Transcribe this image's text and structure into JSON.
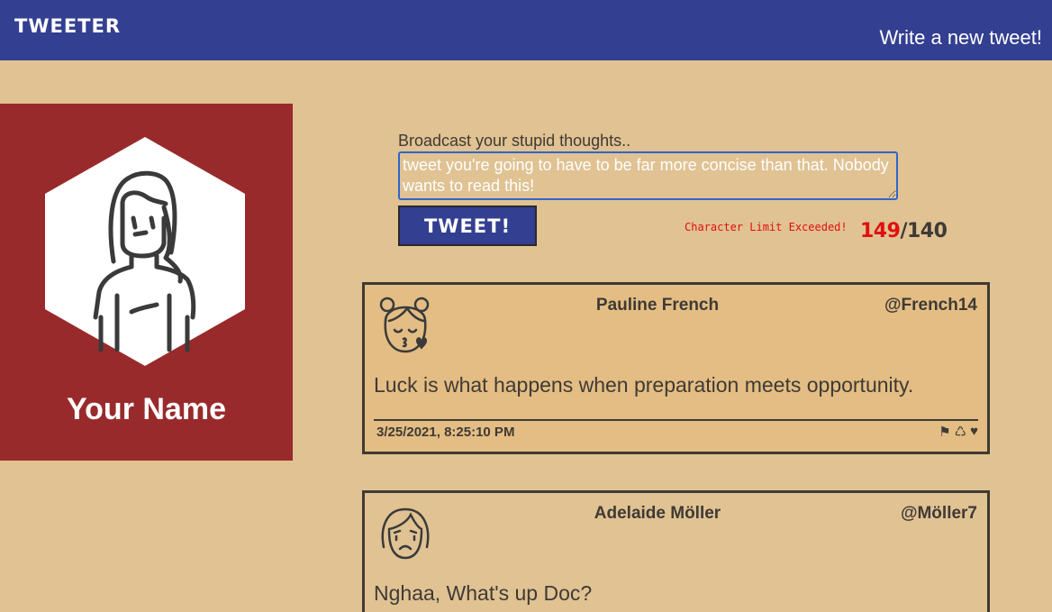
{
  "nav": {
    "brand": "TWEETER",
    "write_link": "Write a new tweet!"
  },
  "profile": {
    "name": "Your Name",
    "avatar_icon": "woman-avatar-icon"
  },
  "compose": {
    "label": "Broadcast your stupid thoughts..",
    "value": "tweet you're going to have to be far more concise than that. Nobody wants to read this!",
    "button_label": "TWEET!",
    "limit_message": "Character Limit Exceeded!",
    "count": "149",
    "separator": "/",
    "max": "140"
  },
  "tweets": [
    {
      "author": "Pauline French",
      "handle": "@French14",
      "text": "Luck is what happens when preparation meets opportunity.",
      "timestamp": "3/25/2021, 8:25:10 PM",
      "avatar_icon": "kissing-face-icon",
      "actions": {
        "flag": "flag-icon",
        "retweet": "retweet-icon",
        "like": "heart-icon"
      }
    },
    {
      "author": "Adelaide Möller",
      "handle": "@Möller7",
      "text": "Nghaa, What's up Doc?",
      "avatar_icon": "sad-face-icon"
    }
  ],
  "colors": {
    "nav": "#333f90",
    "background": "#e0c293",
    "profile_bg": "#992a2b",
    "alert": "#e01010"
  }
}
